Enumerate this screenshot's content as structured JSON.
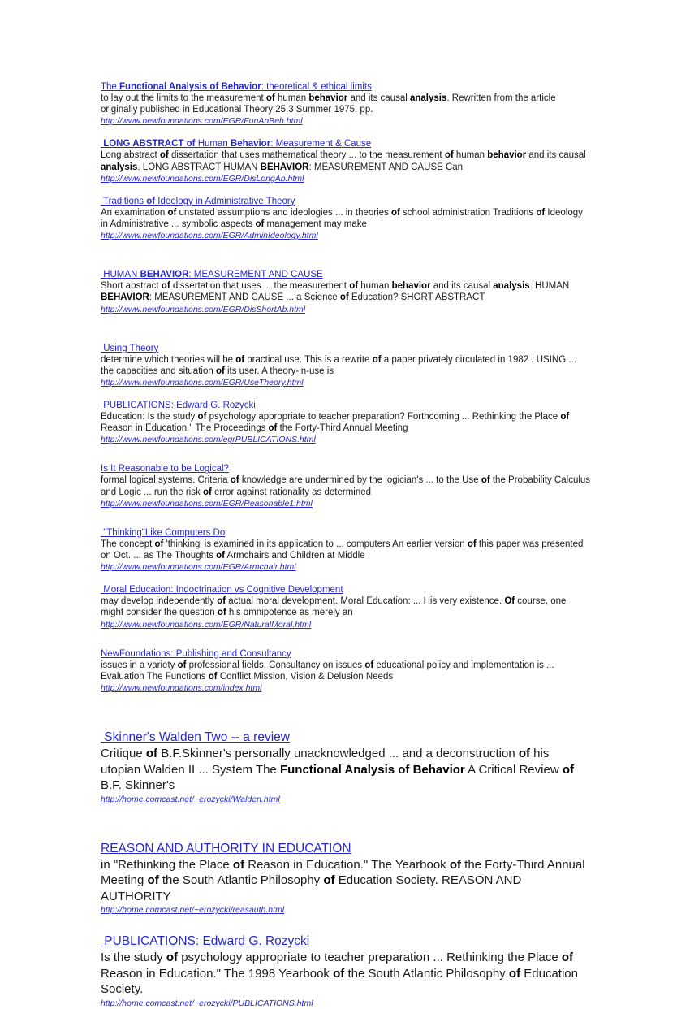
{
  "page": {
    "background": "#ffffff",
    "link_color": "#2727cc",
    "text_color": "#1a1a1a"
  },
  "results": [
    {
      "id": "functional-analysis-of-behavior",
      "size": "small",
      "gap": "gap-0",
      "title_html": "The <b>Functional Analysis of Behavior</b>: theoretical &amp; ethical limits",
      "title_text": "The Functional Analysis of Behavior: theoretical & ethical limits",
      "snippet_html": "to lay out the limits to the measurement <b>of</b> human <b>behavior</b> and its causal <b>analysis</b>. Rewritten from the article originally published in Educational Theory 25,3 Summer 1975, pp.",
      "url": "http://www.newfoundations.com/EGR/FunAnBeh.html"
    },
    {
      "id": "long-abstract-human-behavior",
      "size": "small",
      "gap": "gap-s",
      "title_html": " <b>LONG ABSTRACT of</b> Human <b>Behavior</b>: Measurement &amp; Cause",
      "title_text": "LONG ABSTRACT of Human Behavior: Measurement & Cause",
      "snippet_html": "Long abstract <b>of</b> dissertation that uses mathematical theory ... to the measurement <b>of</b> human <b>behavior</b> and its causal <b>analysis</b>. LONG ABSTRACT HUMAN <b>BEHAVIOR</b>: MEASUREMENT AND CAUSE Can",
      "url": "http://www.newfoundations.com/EGR/DisLongAb.html"
    },
    {
      "id": "traditions-of-ideology",
      "size": "small",
      "gap": "gap-s",
      "title_html": " Traditions <b>of</b> Ideology in Administrative Theory",
      "title_text": "Traditions of Ideology in Administrative Theory",
      "snippet_html": "An examination <b>of</b> unstated assumptions and ideologies ... in theories <b>of</b> school administration Traditions <b>of</b> Ideology in Administrative ... symbolic aspects <b>of</b> management may make",
      "url": "http://www.newfoundations.com/EGR/AdminIdeology.html"
    },
    {
      "id": "human-behavior-measurement-cause",
      "size": "small",
      "gap": "gap-l",
      "title_html": " HUMAN <b>BEHAVIOR</b>: MEASUREMENT AND CAUSE",
      "title_text": "HUMAN BEHAVIOR: MEASUREMENT AND CAUSE",
      "snippet_html": "Short abstract <b>of</b> dissertation that uses ... the measurement <b>of</b> human <b>behavior</b> and its causal <b>analysis</b>. HUMAN <b>BEHAVIOR</b>: MEASUREMENT AND CAUSE ... a Science <b>of</b> Education? SHORT ABSTRACT",
      "url": "http://www.newfoundations.com/EGR/DisShortAb.html"
    },
    {
      "id": "using-theory",
      "size": "small",
      "gap": "gap-l",
      "title_html": " Using Theory",
      "title_text": "Using Theory",
      "snippet_html": "determine which theories will be <b>of</b> practical use. This is a rewrite <b>of</b> a paper privately circulated in 1982 . USING ... the capacities and situation <b>of</b> its user. A theory-in-use is",
      "url": "http://www.newfoundations.com/EGR/UseTheory.html"
    },
    {
      "id": "publications-edward-rozycki-1",
      "size": "small",
      "gap": "gap-s",
      "title_html": " PUBLICATIONS: Edward G. Rozycki",
      "title_text": "PUBLICATIONS: Edward G. Rozycki",
      "snippet_html": "Education: Is the study <b>of</b> psychology appropriate to teacher preparation? Forthcoming ... Rethinking the Place <b>of</b> Reason in Education.\" The Proceedings <b>of</b> the Forty-Third Annual Meeting",
      "url": "http://www.newfoundations.com/egrPUBLICATIONS.html"
    },
    {
      "id": "is-it-reasonable-to-be-logical",
      "size": "small",
      "gap": "gap-m",
      "title_html": "Is It Reasonable to be Logical?",
      "title_text": "Is It Reasonable to be Logical?",
      "snippet_html": "formal logical systems. Criteria <b>of</b> knowledge are undermined by the logician's ... to the Use <b>of</b> the Probability Calculus and Logic ... run the risk <b>of</b> error against rationality as determined",
      "url": "http://www.newfoundations.com/EGR/Reasonable1.html"
    },
    {
      "id": "thinking-like-computers-do",
      "size": "small",
      "gap": "gap-m",
      "title_html": " \"Thinking\"Like Computers Do",
      "title_text": "\"Thinking\"Like Computers Do",
      "snippet_html": "The concept <b>of</b> 'thinking' is examined in its application to ... computers An earlier version <b>of</b> this paper was presented on Oct. ... as The Thoughts <b>of</b> Armchairs and Children at Middle",
      "url": "http://www.newfoundations.com/EGR/Armchair.html"
    },
    {
      "id": "moral-education-indoctrination",
      "size": "small",
      "gap": "gap-s",
      "title_html": " Moral Education: Indoctrination vs Cognitive Development",
      "title_text": "Moral Education: Indoctrination vs Cognitive Development",
      "snippet_html": "may develop independently <b>of</b> actual moral development. Moral Education: ... His very existence. <b>Of</b> course, one might consider the question <b>of</b> his omnipotence as merely an",
      "url": "http://www.newfoundations.com/EGR/NaturalMoral.html"
    },
    {
      "id": "newfoundations-publishing-consultancy",
      "size": "small",
      "gap": "gap-m",
      "title_html": "NewFoundations: Publishing and Consultancy",
      "title_text": "NewFoundations: Publishing and Consultancy",
      "snippet_html": "issues in a variety <b>of</b> professional fields. Consultancy on issues <b>of</b> educational policy and implementation is ... Evaluation The Functions <b>of</b> Conflict Mission, Vision &amp; Delusion Needs",
      "url": "http://www.newfoundations.com/index.html"
    },
    {
      "id": "skinners-walden-two-review",
      "size": "large",
      "gap": "gap-xl",
      "title_html": " Skinner's Walden Two -- a review",
      "title_text": "Skinner's Walden Two -- a review",
      "snippet_html": "Critique <b>of</b> B.F.Skinner's personally unacknowledged ... and a deconstruction <b>of</b> his utopian Walden II ... System The <b>Functional Analysis of Behavior</b> A Critical Review <b>of</b> B.F. Skinner's",
      "url": "http://home.comcast.net/~erozycki/Walden.html"
    },
    {
      "id": "reason-and-authority-in-education",
      "size": "large",
      "gap": "gap-xl",
      "title_html": "REASON AND AUTHORITY IN EDUCATION",
      "title_text": "REASON AND AUTHORITY IN EDUCATION",
      "snippet_html": "in \"Rethinking the Place <b>of</b> Reason in Education.\" The Yearbook <b>of</b> the Forty-Third Annual Meeting <b>of</b> the South Atlantic Philosophy <b>of</b> Education Society. REASON AND AUTHORITY",
      "url": "http://home.comcast.net/~erozycki/reasauth.html"
    },
    {
      "id": "publications-edward-rozycki-2",
      "size": "large",
      "gap": "gap-m",
      "title_html": " PUBLICATIONS: Edward G. Rozycki",
      "title_text": "PUBLICATIONS: Edward G. Rozycki",
      "snippet_html": "Is the study <b>of</b> psychology appropriate to teacher preparation ... Rethinking the Place <b>of</b> Reason in Education.\" The 1998 Yearbook <b>of</b> the South Atlantic Philosophy <b>of</b> Education Society.",
      "url": "http://home.comcast.net/~erozycki/PUBLICATIONS.html"
    }
  ]
}
